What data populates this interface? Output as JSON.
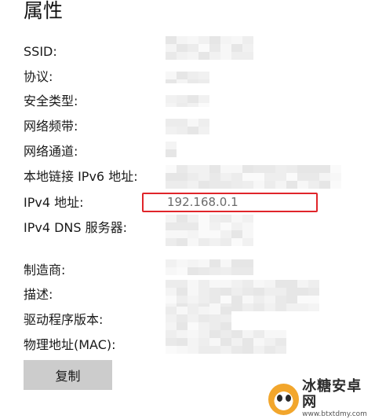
{
  "page": {
    "title": "属性"
  },
  "properties": [
    {
      "label": "SSID:",
      "value": ""
    },
    {
      "label": "协议:",
      "value": ""
    },
    {
      "label": "安全类型:",
      "value": ""
    },
    {
      "label": "网络频带:",
      "value": ""
    },
    {
      "label": "网络通道:",
      "value": ""
    },
    {
      "label": "本地链接 IPv6 地址:",
      "value": ""
    },
    {
      "label": "IPv4 地址:",
      "value": "192.168.0.1"
    },
    {
      "label": "IPv4 DNS 服务器:",
      "value": ""
    },
    {
      "label": "制造商:",
      "value": ""
    },
    {
      "label": "描述:",
      "value": ""
    },
    {
      "label": "驱动程序版本:",
      "value": ""
    },
    {
      "label": "物理地址(MAC):",
      "value": ""
    }
  ],
  "copy_button": {
    "label": "复制"
  },
  "highlight": {
    "color": "#e0252a"
  },
  "watermark": {
    "name": "冰糖安卓网",
    "url": "www.btxtdmy.com",
    "icon": "mascot-logo-icon"
  }
}
